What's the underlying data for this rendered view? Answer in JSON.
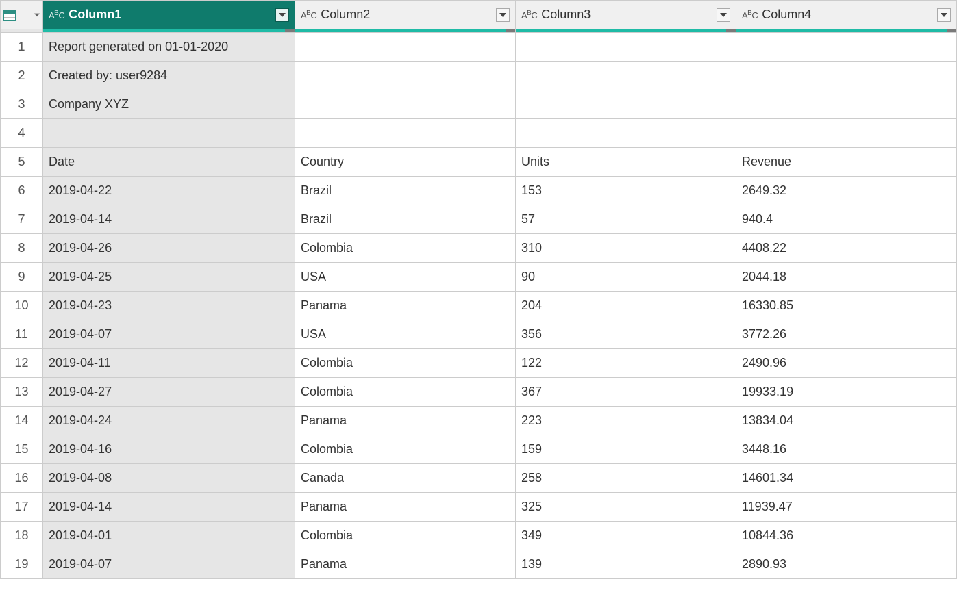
{
  "columns": [
    {
      "name": "Column1",
      "type": "ABC",
      "selected": true
    },
    {
      "name": "Column2",
      "type": "ABC",
      "selected": false
    },
    {
      "name": "Column3",
      "type": "ABC",
      "selected": false
    },
    {
      "name": "Column4",
      "type": "ABC",
      "selected": false
    }
  ],
  "rows": [
    {
      "n": "1",
      "c": [
        "Report generated on 01-01-2020",
        "",
        "",
        ""
      ]
    },
    {
      "n": "2",
      "c": [
        "Created by: user9284",
        "",
        "",
        ""
      ]
    },
    {
      "n": "3",
      "c": [
        "Company XYZ",
        "",
        "",
        ""
      ]
    },
    {
      "n": "4",
      "c": [
        "",
        "",
        "",
        ""
      ]
    },
    {
      "n": "5",
      "c": [
        "Date",
        "Country",
        "Units",
        "Revenue"
      ]
    },
    {
      "n": "6",
      "c": [
        "2019-04-22",
        "Brazil",
        "153",
        "2649.32"
      ]
    },
    {
      "n": "7",
      "c": [
        "2019-04-14",
        "Brazil",
        "57",
        "940.4"
      ]
    },
    {
      "n": "8",
      "c": [
        "2019-04-26",
        "Colombia",
        "310",
        "4408.22"
      ]
    },
    {
      "n": "9",
      "c": [
        "2019-04-25",
        "USA",
        "90",
        "2044.18"
      ]
    },
    {
      "n": "10",
      "c": [
        "2019-04-23",
        "Panama",
        "204",
        "16330.85"
      ]
    },
    {
      "n": "11",
      "c": [
        "2019-04-07",
        "USA",
        "356",
        "3772.26"
      ]
    },
    {
      "n": "12",
      "c": [
        "2019-04-11",
        "Colombia",
        "122",
        "2490.96"
      ]
    },
    {
      "n": "13",
      "c": [
        "2019-04-27",
        "Colombia",
        "367",
        "19933.19"
      ]
    },
    {
      "n": "14",
      "c": [
        "2019-04-24",
        "Panama",
        "223",
        "13834.04"
      ]
    },
    {
      "n": "15",
      "c": [
        "2019-04-16",
        "Colombia",
        "159",
        "3448.16"
      ]
    },
    {
      "n": "16",
      "c": [
        "2019-04-08",
        "Canada",
        "258",
        "14601.34"
      ]
    },
    {
      "n": "17",
      "c": [
        "2019-04-14",
        "Panama",
        "325",
        "11939.47"
      ]
    },
    {
      "n": "18",
      "c": [
        "2019-04-01",
        "Colombia",
        "349",
        "10844.36"
      ]
    },
    {
      "n": "19",
      "c": [
        "2019-04-07",
        "Panama",
        "139",
        "2890.93"
      ]
    }
  ]
}
